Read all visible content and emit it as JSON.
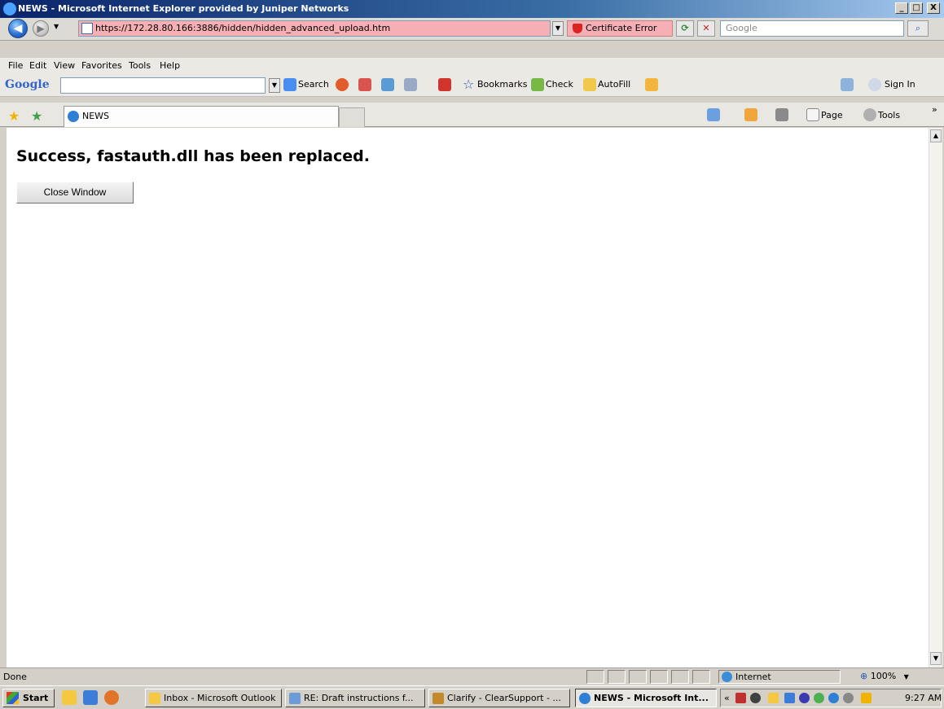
{
  "window": {
    "title": "NEWS - Microsoft Internet Explorer provided by Juniper Networks",
    "min": "_",
    "max": "□",
    "close": "X"
  },
  "nav": {
    "address": "https://172.28.80.166:3886/hidden/hidden_advanced_upload.htm",
    "cert_error": "Certificate Error",
    "search_placeholder": "Google"
  },
  "menu": [
    "File",
    "Edit",
    "View",
    "Favorites",
    "Tools",
    "Help"
  ],
  "google_toolbar": {
    "logo": "Google",
    "search": "Search",
    "bookmarks": "Bookmarks",
    "check": "Check",
    "autofill": "AutoFill",
    "sign_in": "Sign In"
  },
  "tabs": {
    "active_tab": "NEWS",
    "page_menu": "Page",
    "tools_menu": "Tools",
    "more": "»"
  },
  "page": {
    "heading": "Success, fastauth.dll has been replaced.",
    "close_button": "Close Window"
  },
  "status": {
    "text": "Done",
    "zone": "Internet",
    "zoom": "100%"
  },
  "taskbar": {
    "start": "Start",
    "items": [
      "Inbox - Microsoft Outlook",
      "RE: Draft instructions f...",
      "Clarify - ClearSupport - ...",
      "NEWS - Microsoft Int..."
    ],
    "clock": "9:27 AM"
  }
}
